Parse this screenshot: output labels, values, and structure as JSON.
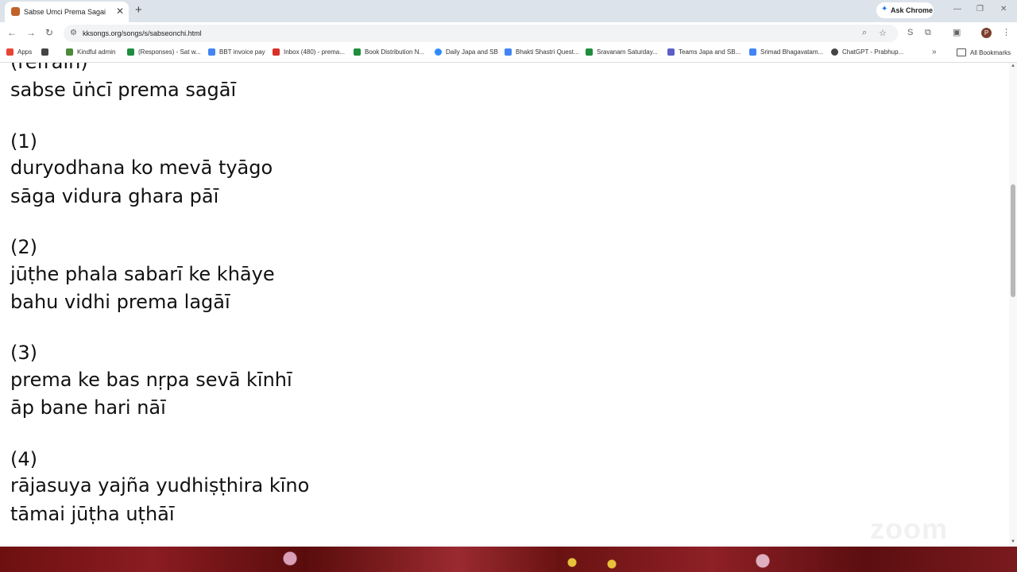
{
  "browser": {
    "tab": {
      "title": "Sabse Umci Prema Sagai",
      "close": "✕"
    },
    "new_tab": "+",
    "ask_chrome": {
      "icon": "sparkle-icon",
      "label": "Ask Chrome"
    },
    "window_controls": {
      "minimize": "—",
      "restore": "❐",
      "close": "✕"
    },
    "nav": {
      "back": "←",
      "forward": "→",
      "reload": "↻"
    },
    "url": "kksongs.org/songs/s/sabseonchi.html",
    "extension_s": "S",
    "profile_initial": "P",
    "menu": "⋮"
  },
  "bookmarks": {
    "items": [
      {
        "label": "Apps",
        "icon": "apps-grid-icon",
        "color": "#ea4335"
      },
      {
        "label": "",
        "icon": "grid-icon",
        "color": "#444444"
      },
      {
        "label": "Kindful admin",
        "icon": "kindful-icon",
        "color": "#4c8a3a"
      },
      {
        "label": "(Responses) - Sat w...",
        "icon": "sheets-icon",
        "color": "#1e8e3e"
      },
      {
        "label": "BBT invoice pay",
        "icon": "bbt-icon",
        "color": "#4285f4"
      },
      {
        "label": "Inbox (480) - prema...",
        "icon": "gmail-icon",
        "color": "#d93025"
      },
      {
        "label": "Book Distribution N...",
        "icon": "sheets-icon",
        "color": "#1e8e3e"
      },
      {
        "label": "Daily Japa and SB",
        "icon": "zoom-icon",
        "color": "#2d8cff"
      },
      {
        "label": "Bhakti Shastri Quest...",
        "icon": "docs-icon",
        "color": "#4285f4"
      },
      {
        "label": "Sravanam Saturday...",
        "icon": "sheets-icon",
        "color": "#1e8e3e"
      },
      {
        "label": "Teams Japa and SB...",
        "icon": "teams-icon",
        "color": "#5b5fc7"
      },
      {
        "label": "Srimad Bhagavatam...",
        "icon": "docs-icon",
        "color": "#4285f4"
      },
      {
        "label": "ChatGPT - Prabhup...",
        "icon": "chatgpt-icon",
        "color": "#444444"
      }
    ],
    "more": "»",
    "all_bookmarks": "All Bookmarks"
  },
  "lyrics": [
    "(refrain)",
    "sabse ūṅcī prema sagāī",
    "(1)",
    "duryodhana ko mevā tyāgo",
    "sāga vidura ghara pāī",
    "(2)",
    "jūṭhe phala sabarī ke khāye",
    "bahu vidhi prema lagāī",
    "(3)",
    "prema ke bas nṛpa sevā kīnhī",
    "āp bane hari nāī",
    "(4)",
    "rājasuya yajña yudhiṣṭhira kīno",
    "tāmai jūṭha uṭhāī"
  ],
  "scrollbar": {
    "up": "▲",
    "down": "▼"
  },
  "watermark": "zoom"
}
